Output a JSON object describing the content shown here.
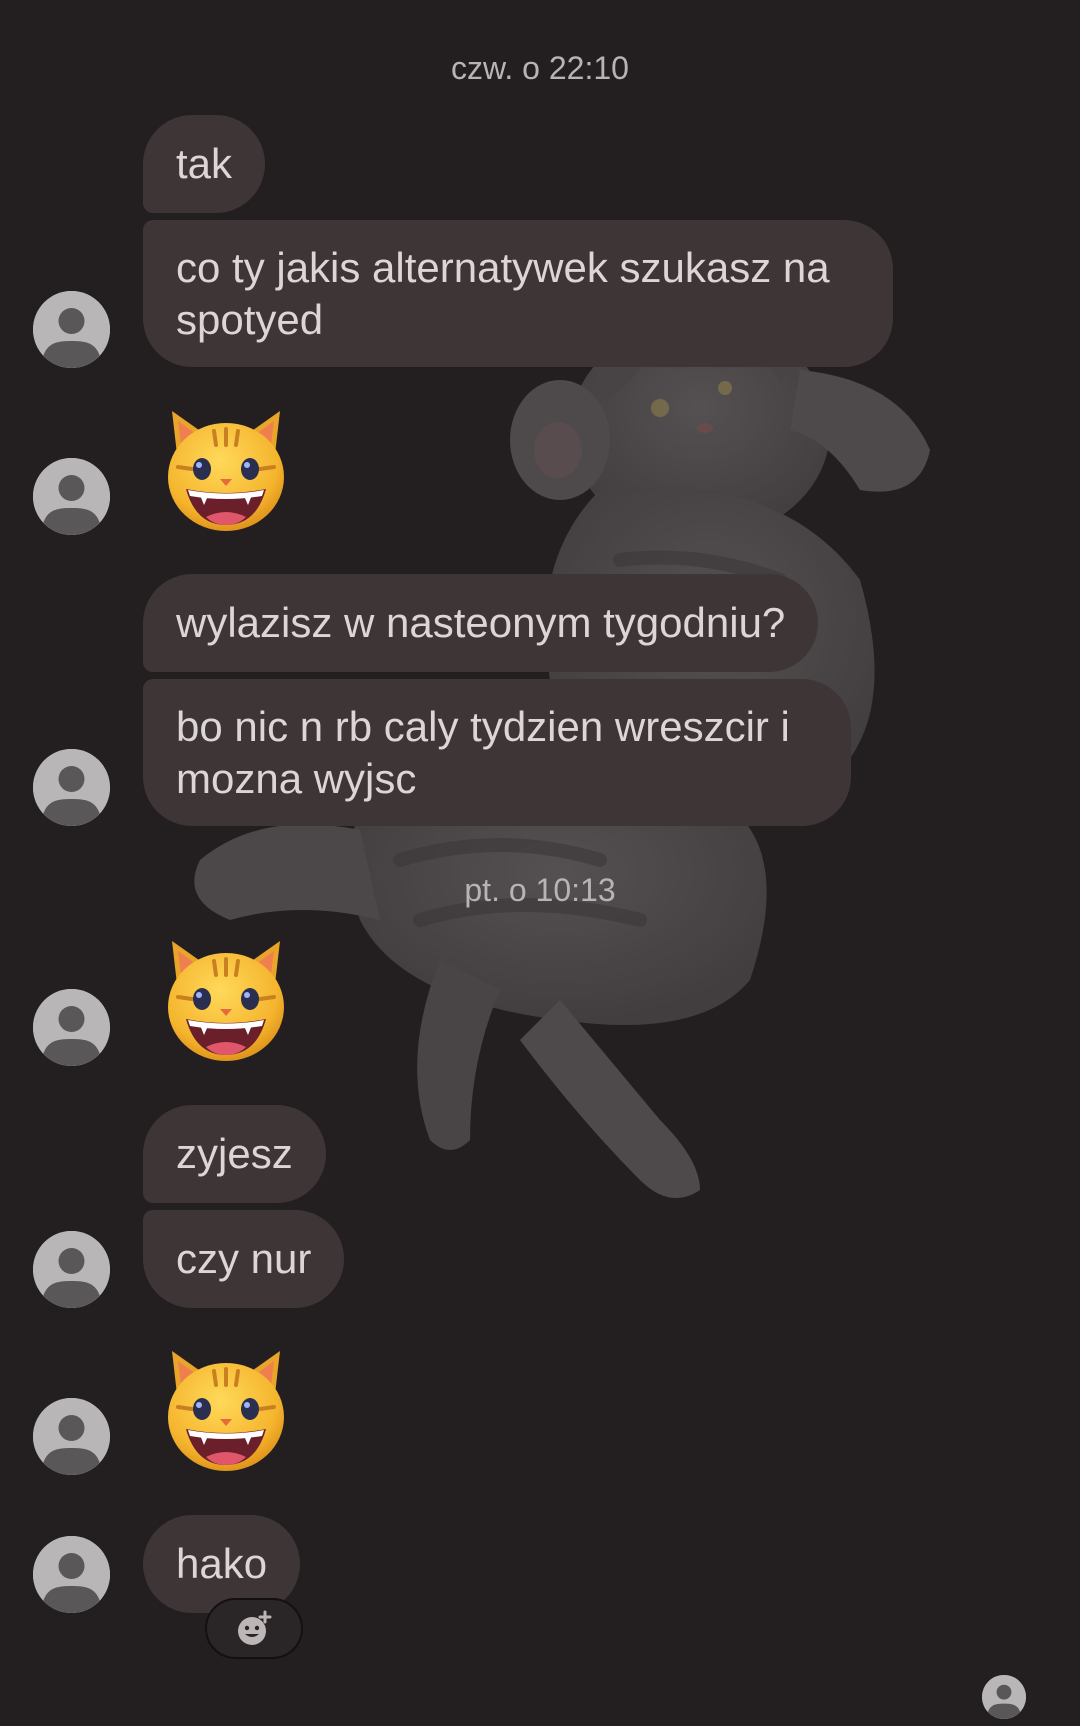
{
  "conversation": {
    "timestamps": {
      "first": "czw. o 22:10",
      "second": "pt. o 10:13"
    },
    "messages": {
      "m1": "tak",
      "m2": "co ty jakis alternatywek szukasz na spotyed",
      "m3": "wylazisz w nasteonym tygodniu?",
      "m4": "bo nic n rb caly tydzien wreszcir i mozna wyjsc",
      "m5": "zyjesz",
      "m6": "czy nur",
      "m7": "hako"
    },
    "emoji_messages": [
      "grinning-cat-emoji",
      "grinning-cat-emoji",
      "grinning-cat-emoji"
    ]
  },
  "icons": {
    "avatar": "default-person-avatar-icon",
    "reaction": "add-reaction-icon",
    "read_receipt": "seen-avatar-icon",
    "background": "cat-chat-theme"
  },
  "colors": {
    "background": "#231f20",
    "bubble": "#3e3537",
    "bubble_text": "#dcd6d6",
    "timestamp_text": "#b9b3b3",
    "avatar": "#b8b6b7"
  }
}
